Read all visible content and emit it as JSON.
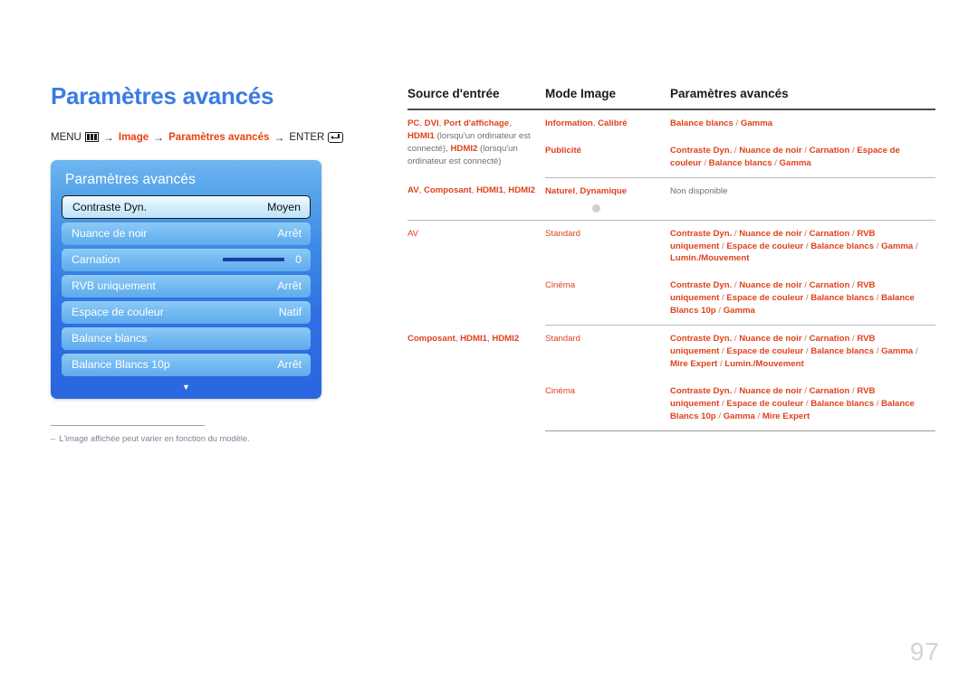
{
  "page": {
    "title": "Paramètres avancés",
    "number": "97",
    "title_color": "#3b7ce5",
    "accent_color": "#e0411c"
  },
  "breadcrumb": {
    "menu_label": "MENU",
    "menu_icon": "menu-bars-icon",
    "arrow": "→",
    "step1": "Image",
    "step2": "Paramètres avancés",
    "enter_label": "ENTER",
    "enter_icon": "enter-return-icon"
  },
  "osd": {
    "title": "Paramètres avancés",
    "down_arrow": "▼",
    "rows": [
      {
        "label": "Contraste Dyn.",
        "value": "Moyen",
        "selected": true,
        "slider": false
      },
      {
        "label": "Nuance de noir",
        "value": "Arrêt",
        "selected": false,
        "slider": false
      },
      {
        "label": "Carnation",
        "value": "0",
        "selected": false,
        "slider": true
      },
      {
        "label": "RVB uniquement",
        "value": "Arrêt",
        "selected": false,
        "slider": false
      },
      {
        "label": "Espace de couleur",
        "value": "Natif",
        "selected": false,
        "slider": false
      },
      {
        "label": "Balance blancs",
        "value": "",
        "selected": false,
        "slider": false
      },
      {
        "label": "Balance Blancs 10p",
        "value": "Arrêt",
        "selected": false,
        "slider": false
      }
    ]
  },
  "footnote": {
    "dash": "–",
    "text": "L'image affichée peut varier en fonction du modèle."
  },
  "table": {
    "headers": [
      "Source d'entrée",
      "Mode Image",
      "Paramètres avancés"
    ],
    "rows": [
      {
        "source_html": "<span class=\"b\">PC</span>, <span class=\"b\">DVI</span>, <span class=\"b\">Port d'affichage</span>, <span class=\"b\">HDMI1</span> <span class=\"gray\">(lorsqu'un ordinateur est connecté)</span>, <span class=\"b\">HDMI2</span> <span class=\"gray\">(lorsqu'un ordinateur est connecté)</span>",
        "source_text": "PC, DVI, Port d'affichage, HDMI1 (lorsqu'un ordinateur est connecté), HDMI2 (lorsqu'un ordinateur est connecté)",
        "source_rowspan": 2,
        "mode_html": "<span class=\"b\">Information</span>, <span class=\"b\">Calibré</span>",
        "mode_text": "Information, Calibré",
        "settings_html": "<span class=\"b\">Balance blancs</span> <span class=\"sep\">/</span> <span class=\"b\">Gamma</span>",
        "settings_text": "Balance blancs / Gamma",
        "dot": false
      },
      {
        "source_html": "",
        "source_text": "",
        "source_rowspan": 0,
        "mode_html": "<span class=\"b\">Publicité</span>",
        "mode_text": "Publicité",
        "settings_html": "<span class=\"b\">Contraste Dyn.</span> <span class=\"sep\">/</span> <span class=\"b\">Nuance de noir</span> <span class=\"sep\">/</span> <span class=\"b\">Carnation</span> <span class=\"sep\">/</span> <span class=\"b\">Espace de couleur</span> <span class=\"sep\">/</span> <span class=\"b\">Balance blancs</span> <span class=\"sep\">/</span> <span class=\"b\">Gamma</span>",
        "settings_text": "Contraste Dyn. / Nuance de noir / Carnation / Espace de couleur / Balance blancs / Gamma",
        "dot": false
      },
      {
        "source_html": "<span class=\"b\">AV</span>, <span class=\"b\">Composant</span>, <span class=\"b\">HDMI1</span>, <span class=\"b\">HDMI2</span>",
        "source_text": "AV, Composant, HDMI1, HDMI2",
        "source_rowspan": 1,
        "mode_html": "<span class=\"b\">Naturel</span>, <span class=\"b\">Dynamique</span>",
        "mode_text": "Naturel, Dynamique",
        "settings_html": "<span class=\"gray\">Non disponible</span>",
        "settings_text": "Non disponible",
        "dot": true
      },
      {
        "source_html": "AV",
        "source_text": "AV",
        "source_rowspan": 2,
        "mode_html": "Standard",
        "mode_text": "Standard",
        "settings_html": "<span class=\"b\">Contraste Dyn.</span> <span class=\"sep\">/</span> <span class=\"b\">Nuance de noir</span> <span class=\"sep\">/</span> <span class=\"b\">Carnation</span> <span class=\"sep\">/</span> <span class=\"b\">RVB uniquement</span> <span class=\"sep\">/</span> <span class=\"b\">Espace de couleur</span> <span class=\"sep\">/</span> <span class=\"b\">Balance blancs</span> <span class=\"sep\">/</span> <span class=\"b\">Gamma</span> <span class=\"sep\">/</span> <span class=\"b\">Lumin./Mouvement</span>",
        "settings_text": "Contraste Dyn. / Nuance de noir / Carnation / RVB uniquement / Espace de couleur / Balance blancs / Gamma / Lumin./Mouvement",
        "dot": false
      },
      {
        "source_html": "",
        "source_text": "",
        "source_rowspan": 0,
        "mode_html": "Cinéma",
        "mode_text": "Cinéma",
        "settings_html": "<span class=\"b\">Contraste Dyn.</span> <span class=\"sep\">/</span> <span class=\"b\">Nuance de noir</span> <span class=\"sep\">/</span> <span class=\"b\">Carnation</span> <span class=\"sep\">/</span> <span class=\"b\">RVB uniquement</span> <span class=\"sep\">/</span> <span class=\"b\">Espace de couleur</span> <span class=\"sep\">/</span> <span class=\"b\">Balance blancs</span> <span class=\"sep\">/</span> <span class=\"b\">Balance Blancs 10p</span> <span class=\"sep\">/</span> <span class=\"b\">Gamma</span>",
        "settings_text": "Contraste Dyn. / Nuance de noir / Carnation / RVB uniquement / Espace de couleur / Balance blancs / Balance Blancs 10p / Gamma",
        "dot": false
      },
      {
        "source_html": "<span class=\"b\">Composant</span>, <span class=\"b\">HDMI1</span>, <span class=\"b\">HDMI2</span>",
        "source_text": "Composant, HDMI1, HDMI2",
        "source_rowspan": 2,
        "mode_html": "Standard",
        "mode_text": "Standard",
        "settings_html": "<span class=\"b\">Contraste Dyn.</span> <span class=\"sep\">/</span> <span class=\"b\">Nuance de noir</span> <span class=\"sep\">/</span> <span class=\"b\">Carnation</span> <span class=\"sep\">/</span> <span class=\"b\">RVB uniquement</span> <span class=\"sep\">/</span> <span class=\"b\">Espace de couleur</span> <span class=\"sep\">/</span> <span class=\"b\">Balance blancs</span> <span class=\"sep\">/</span> <span class=\"b\">Gamma</span> <span class=\"sep\">/</span> <span class=\"b\">Mire Expert</span> <span class=\"sep\">/</span> <span class=\"b\">Lumin./Mouvement</span>",
        "settings_text": "Contraste Dyn. / Nuance de noir / Carnation / RVB uniquement / Espace de couleur / Balance blancs / Gamma / Mire Expert / Lumin./Mouvement",
        "dot": false
      },
      {
        "source_html": "",
        "source_text": "",
        "source_rowspan": 0,
        "mode_html": "Cinéma",
        "mode_text": "Cinéma",
        "settings_html": "<span class=\"b\">Contraste Dyn.</span> <span class=\"sep\">/</span> <span class=\"b\">Nuance de noir</span> <span class=\"sep\">/</span> <span class=\"b\">Carnation</span> <span class=\"sep\">/</span> <span class=\"b\">RVB uniquement</span> <span class=\"sep\">/</span> <span class=\"b\">Espace de couleur</span> <span class=\"sep\">/</span> <span class=\"b\">Balance blancs</span> <span class=\"sep\">/</span> <span class=\"b\">Balance Blancs 10p</span> <span class=\"sep\">/</span> <span class=\"b\">Gamma</span> <span class=\"sep\">/</span> <span class=\"b\">Mire Expert</span>",
        "settings_text": "Contraste Dyn. / Nuance de noir / Carnation / RVB uniquement / Espace de couleur / Balance blancs / Balance Blancs 10p / Gamma / Mire Expert",
        "dot": false
      }
    ]
  }
}
